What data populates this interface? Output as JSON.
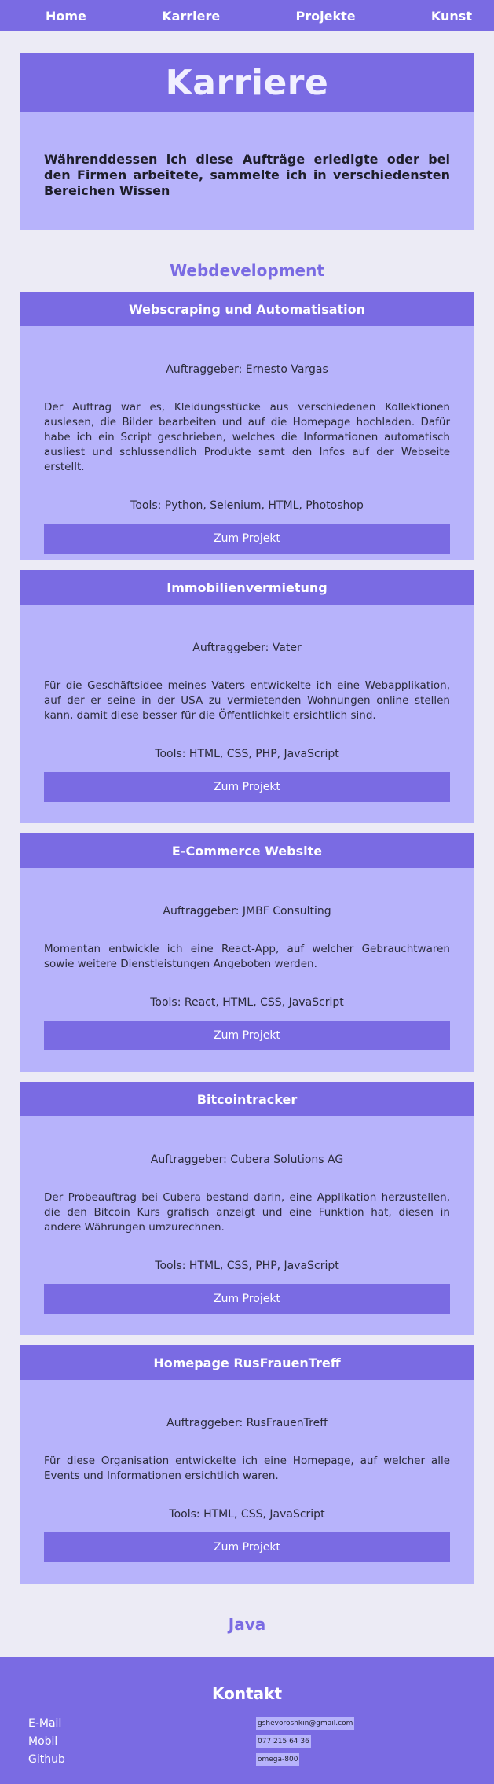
{
  "nav": {
    "items": [
      "Home",
      "Karriere",
      "Projekte",
      "Kunst"
    ]
  },
  "hero": {
    "title": "Karriere",
    "text": "Währenddessen ich diese Aufträge erledigte oder bei den Firmen arbeitete, sammelte ich in verschiedensten Bereichen Wissen"
  },
  "sections": {
    "webdev_title": "Webdevelopment",
    "java_title": "Java"
  },
  "projects": [
    {
      "title": "Webscraping und Automatisation",
      "client": "Auftraggeber: Ernesto Vargas",
      "description": "Der Auftrag war es, Kleidungsstücke aus verschiedenen Kollektionen auslesen, die Bilder bearbeiten und auf die Homepage hochladen. Dafür habe ich ein Script geschrieben, welches die Informationen automatisch ausliest und schlussendlich Produkte samt den Infos auf der Webseite erstellt.",
      "tools": "Tools: Python, Selenium, HTML, Photoshop",
      "button": "Zum Projekt"
    },
    {
      "title": "Immobilienvermietung",
      "client": "Auftraggeber: Vater",
      "description": "Für die Geschäftsidee meines Vaters entwickelte ich eine Webapplikation, auf der er seine in der USA zu vermietenden Wohnungen online stellen kann, damit diese besser für die Öffentlichkeit ersichtlich sind.",
      "tools": "Tools: HTML, CSS, PHP, JavaScript",
      "button": "Zum Projekt"
    },
    {
      "title": "E-Commerce Website",
      "client": "Auftraggeber: JMBF Consulting",
      "description": "Momentan entwickle ich eine React-App, auf welcher Gebrauchtwaren sowie weitere Dienstleistungen Angeboten werden.",
      "tools": "Tools: React, HTML, CSS, JavaScript",
      "button": "Zum Projekt"
    },
    {
      "title": "Bitcointracker",
      "client": "Auftraggeber: Cubera Solutions AG",
      "description": "Der Probeauftrag bei Cubera bestand darin, eine Applikation herzustellen, die den Bitcoin Kurs grafisch anzeigt und eine Funktion hat, diesen in andere Währungen umzurechnen.",
      "tools": "Tools: HTML, CSS, PHP, JavaScript",
      "button": "Zum Projekt"
    },
    {
      "title": "Homepage RusFrauenTreff",
      "client": "Auftraggeber: RusFrauenTreff",
      "description": "Für diese Organisation entwickelte ich eine Homepage, auf welcher alle Events und Informationen ersichtlich waren.",
      "tools": "Tools: HTML, CSS, JavaScript",
      "button": "Zum Projekt"
    }
  ],
  "footer": {
    "title": "Kontakt",
    "contacts": [
      {
        "label": "E-Mail",
        "value": "gshevoroshkin@gmail.com"
      },
      {
        "label": "Mobil",
        "value": "077 215 64 36"
      },
      {
        "label": "Github",
        "value": "omega-800"
      }
    ]
  }
}
